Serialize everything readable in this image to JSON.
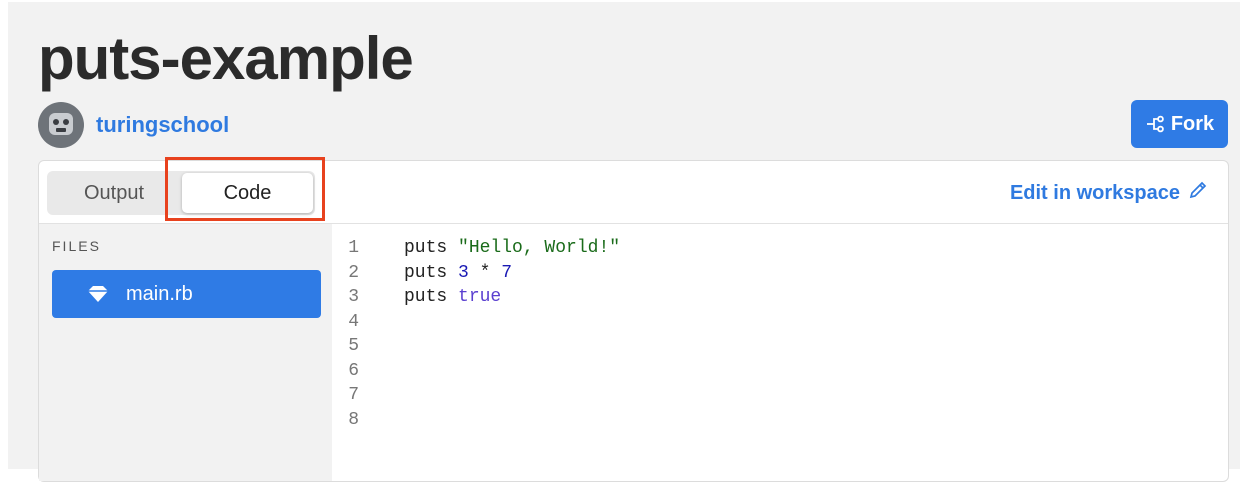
{
  "project": {
    "title": "puts-example",
    "owner": "turingschool"
  },
  "actions": {
    "fork_label": "Fork",
    "edit_label": "Edit in workspace"
  },
  "tabs": [
    {
      "label": "Output",
      "active": false
    },
    {
      "label": "Code",
      "active": true
    }
  ],
  "sidebar": {
    "heading": "FILES",
    "files": [
      {
        "name": "main.rb",
        "selected": true,
        "icon": "ruby-icon"
      }
    ]
  },
  "editor": {
    "lines": [
      {
        "n": "1",
        "tokens": [
          {
            "t": "puts ",
            "c": "kw"
          },
          {
            "t": "\"Hello, World!\"",
            "c": "str"
          }
        ]
      },
      {
        "n": "2",
        "tokens": [
          {
            "t": "puts ",
            "c": "kw"
          },
          {
            "t": "3",
            "c": "num"
          },
          {
            "t": " * ",
            "c": "kw"
          },
          {
            "t": "7",
            "c": "num"
          }
        ]
      },
      {
        "n": "3",
        "tokens": [
          {
            "t": "puts ",
            "c": "kw"
          },
          {
            "t": "true",
            "c": "bool"
          }
        ]
      },
      {
        "n": "4",
        "tokens": []
      },
      {
        "n": "5",
        "tokens": []
      },
      {
        "n": "6",
        "tokens": []
      },
      {
        "n": "7",
        "tokens": []
      },
      {
        "n": "8",
        "tokens": []
      }
    ]
  },
  "colors": {
    "accent": "#2f7be5",
    "highlight_box": "#e8421e"
  }
}
